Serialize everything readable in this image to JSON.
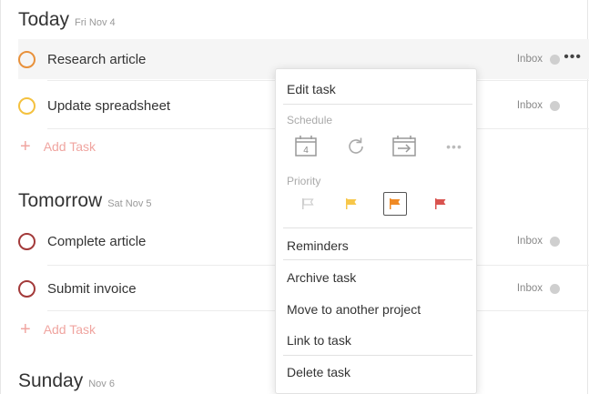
{
  "today": {
    "title": "Today",
    "date": "Fri Nov 4",
    "tasks": [
      {
        "name": "Research article",
        "project": "Inbox",
        "circle_color": "#e8913b"
      },
      {
        "name": "Update spreadsheet",
        "project": "Inbox",
        "circle_color": "#f4c13f"
      }
    ],
    "add_task_label": "Add Task"
  },
  "tomorrow": {
    "title": "Tomorrow",
    "date": "Sat Nov 5",
    "tasks": [
      {
        "name": "Complete article",
        "project": "Inbox",
        "circle_color": "#a33a3a"
      },
      {
        "name": "Submit invoice",
        "project": "Inbox",
        "circle_color": "#a33a3a"
      }
    ],
    "add_task_label": "Add Task"
  },
  "sunday": {
    "title": "Sunday",
    "date": "Nov 6"
  },
  "more_icon": "more-horizontal-icon",
  "context_menu": {
    "edit_task": "Edit task",
    "schedule_label": "Schedule",
    "schedule_icons": [
      "calendar-day-icon",
      "repeat-icon",
      "postpone-icon",
      "more-options-icon"
    ],
    "calendar_day": "4",
    "priority_label": "Priority",
    "priority_colors": [
      "#cfcfcf",
      "#f7c74a",
      "#f08a24",
      "#d9534f"
    ],
    "selected_priority": 3,
    "reminders": "Reminders",
    "archive_task": "Archive task",
    "move_project": "Move to another project",
    "link_task": "Link to task",
    "delete_task": "Delete task"
  }
}
